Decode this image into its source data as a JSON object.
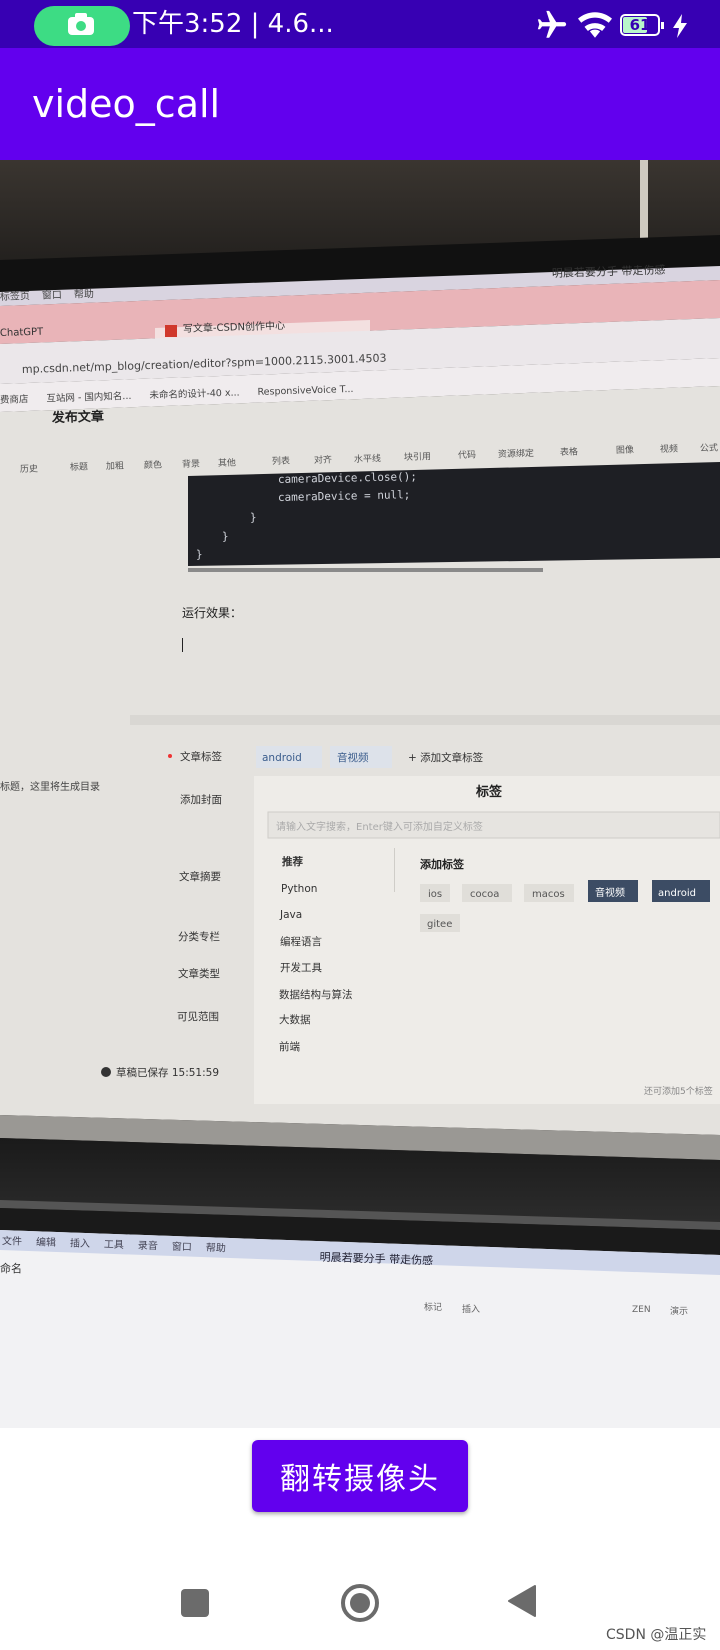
{
  "status_bar": {
    "text": "下午3:52 | 4.6...",
    "battery_level": "61",
    "icons": [
      "camera-icon",
      "airplane-icon",
      "wifi-icon",
      "battery-icon",
      "charging-icon"
    ]
  },
  "app_bar": {
    "title": "video_call"
  },
  "camera_preview": {
    "browser_tabs": [
      "ChatGPT",
      "写文章-CSDN创作中心"
    ],
    "address": "mp.csdn.net/mp_blog/creation/editor?spm=1000.2115.3001.4503",
    "bookmarks": [
      "费商店",
      "互站网 - 国内知名...",
      "未命名的设计-40 x...",
      "ResponsiveVoice T..."
    ],
    "menu_items": [
      "标签页",
      "窗口",
      "帮助"
    ],
    "song_title": "明晨若要分手 带走伤感",
    "editor_title": "发布文章",
    "toolbar": [
      "历史",
      "标题",
      "加粗",
      "颜色",
      "背景",
      "其他",
      "列表",
      "对齐",
      "水平线",
      "块引用",
      "代码",
      "资源绑定",
      "表格",
      "图像",
      "视频",
      "公式"
    ],
    "code_lines": [
      "cameraDevice.close();",
      "cameraDevice = null;",
      "}",
      "}",
      "}"
    ],
    "run_result_label": "运行效果：",
    "toc_hint": "标题，这里将生成目录",
    "form_labels": [
      "文章标签",
      "添加封面",
      "文章摘要",
      "分类专栏",
      "文章类型",
      "可见范围"
    ],
    "tag_chips": [
      "android",
      "音视频"
    ],
    "add_tag_link": "+ 添加文章标签",
    "tag_panel": {
      "title": "标签",
      "search_placeholder": "请输入文字搜索，Enter键入可添加自定义标签",
      "categories": [
        "推荐",
        "Python",
        "Java",
        "编程语言",
        "开发工具",
        "数据结构与算法",
        "大数据",
        "前端"
      ],
      "add_title": "添加标签",
      "tags": [
        "ios",
        "cocoa",
        "macos",
        "音视频",
        "android",
        "gitee"
      ],
      "footer": "还可添加5个标签"
    },
    "draft_saved": "草稿已保存 15:51:59",
    "second_screen_menu": [
      "文件",
      "编辑",
      "插入",
      "工具",
      "录音",
      "窗口",
      "帮助"
    ],
    "second_screen_title": "命名",
    "second_screen_tools": [
      "标记",
      "插入",
      "ZEN",
      "演示"
    ]
  },
  "flip_button": {
    "label": "翻转摄像头"
  },
  "watermark": "CSDN @温正实"
}
